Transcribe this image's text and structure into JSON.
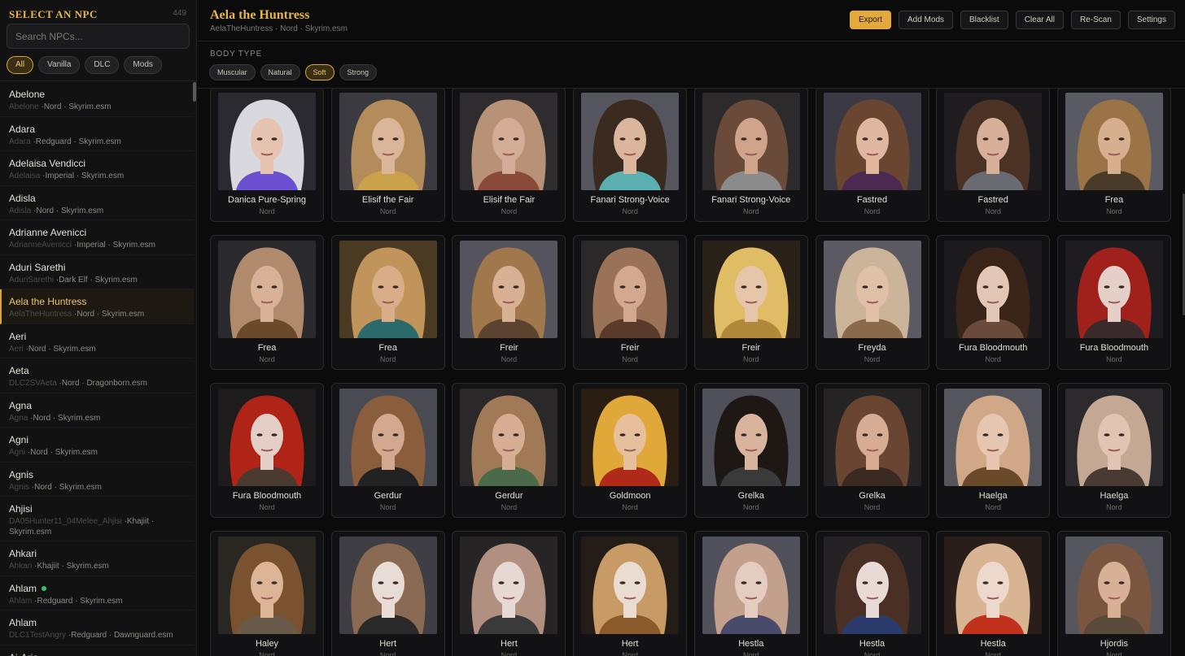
{
  "sidebar": {
    "title": "SELECT AN NPC",
    "count": "449",
    "search_placeholder": "Search NPCs...",
    "filters": [
      {
        "label": "All",
        "active": true
      },
      {
        "label": "Vanilla",
        "active": false
      },
      {
        "label": "DLC",
        "active": false
      },
      {
        "label": "Mods",
        "active": false
      }
    ],
    "npcs": [
      {
        "name": "Abelone",
        "id": "Abelone",
        "race": "Nord",
        "plugin": "Skyrim.esm"
      },
      {
        "name": "Adara",
        "id": "Adara",
        "race": "Redguard",
        "plugin": "Skyrim.esm"
      },
      {
        "name": "Adelaisa Vendicci",
        "id": "Adelaisa",
        "race": "Imperial",
        "plugin": "Skyrim.esm"
      },
      {
        "name": "Adisla",
        "id": "Adisla",
        "race": "Nord",
        "plugin": "Skyrim.esm"
      },
      {
        "name": "Adrianne Avenicci",
        "id": "AdrianneAvenicci",
        "race": "Imperial",
        "plugin": "Skyrim.esm"
      },
      {
        "name": "Aduri Sarethi",
        "id": "AduriSarethi",
        "race": "Dark Elf",
        "plugin": "Skyrim.esm"
      },
      {
        "name": "Aela the Huntress",
        "id": "AelaTheHuntress",
        "race": "Nord",
        "plugin": "Skyrim.esm",
        "selected": true
      },
      {
        "name": "Aeri",
        "id": "Aeri",
        "race": "Nord",
        "plugin": "Skyrim.esm"
      },
      {
        "name": "Aeta",
        "id": "DLC2SVAeta",
        "race": "Nord",
        "plugin": "Dragonborn.esm"
      },
      {
        "name": "Agna",
        "id": "Agna",
        "race": "Nord",
        "plugin": "Skyrim.esm"
      },
      {
        "name": "Agni",
        "id": "Agni",
        "race": "Nord",
        "plugin": "Skyrim.esm"
      },
      {
        "name": "Agnis",
        "id": "Agnis",
        "race": "Nord",
        "plugin": "Skyrim.esm"
      },
      {
        "name": "Ahjisi",
        "id": "DA05Hunter11_04Melee_Ahjisi",
        "race": "Khajiit",
        "plugin": "Skyrim.esm"
      },
      {
        "name": "Ahkari",
        "id": "Ahkari",
        "race": "Khajiit",
        "plugin": "Skyrim.esm"
      },
      {
        "name": "Ahlam",
        "id": "Ahlam",
        "race": "Redguard",
        "plugin": "Skyrim.esm",
        "status": "green"
      },
      {
        "name": "Ahlam",
        "id": "DLC1TestAngry",
        "race": "Redguard",
        "plugin": "Dawnguard.esm"
      },
      {
        "name": "Ai-Aria",
        "id": "",
        "race": "",
        "plugin": ""
      }
    ]
  },
  "header": {
    "title": "Aela the Huntress",
    "subtitle": "AelaTheHuntress · Nord · Skyrim.esm",
    "actions": [
      "Export",
      "Add Mods",
      "Blacklist",
      "Clear All",
      "Re-Scan",
      "Settings"
    ]
  },
  "body_type": {
    "label": "BODY TYPE",
    "options": [
      {
        "label": "Muscular",
        "active": false
      },
      {
        "label": "Natural",
        "active": false
      },
      {
        "label": "Soft",
        "active": true
      },
      {
        "label": "Strong",
        "active": false
      }
    ]
  },
  "presets": [
    {
      "name": "Danica Pure-Spring",
      "race": "Nord",
      "hair": "#d8d8de",
      "skin": "#e6c3b0",
      "bg": "#2a2a30",
      "accent": "#6a4fd0"
    },
    {
      "name": "Elisif the Fair",
      "race": "Nord",
      "hair": "#b48c5c",
      "skin": "#dab59a",
      "bg": "#3a3a40",
      "accent": "#c9a24a"
    },
    {
      "name": "Elisif the Fair",
      "race": "Nord",
      "hair": "#b89276",
      "skin": "#d4ad96",
      "bg": "#2e2c2e",
      "accent": "#8a4a3a"
    },
    {
      "name": "Fanari Strong-Voice",
      "race": "Nord",
      "hair": "#3a2a20",
      "skin": "#dcb69c",
      "bg": "#55555d",
      "accent": "#5ab0b0"
    },
    {
      "name": "Fanari Strong-Voice",
      "race": "Nord",
      "hair": "#6a4a38",
      "skin": "#cfa48a",
      "bg": "#2c2a2b",
      "accent": "#8b8b8b"
    },
    {
      "name": "Fastred",
      "race": "Nord",
      "hair": "#6a4630",
      "skin": "#deb79e",
      "bg": "#3b3a44",
      "accent": "#4a2a50"
    },
    {
      "name": "Fastred",
      "race": "Nord",
      "hair": "#4a3224",
      "skin": "#d8b09a",
      "bg": "#1e1c1e",
      "accent": "#6a6a72"
    },
    {
      "name": "Frea",
      "race": "Nord",
      "hair": "#9a7446",
      "skin": "#d6b08e",
      "bg": "#5a5a62",
      "accent": "#4a3a2a"
    },
    {
      "name": "Frea",
      "race": "Nord",
      "hair": "#b08a6c",
      "skin": "#d8b196",
      "bg": "#2a2a2e",
      "accent": "#6a4a2a"
    },
    {
      "name": "Frea",
      "race": "Nord",
      "hair": "#c0945a",
      "skin": "#d9ad88",
      "bg": "#4a3a22",
      "accent": "#2a6a6a"
    },
    {
      "name": "Freir",
      "race": "Nord",
      "hair": "#a0784c",
      "skin": "#d8b094",
      "bg": "#55545c",
      "accent": "#5a4430"
    },
    {
      "name": "Freir",
      "race": "Nord",
      "hair": "#9a7258",
      "skin": "#d2a88e",
      "bg": "#2a2829",
      "accent": "#5a3a2a"
    },
    {
      "name": "Freir",
      "race": "Nord",
      "hair": "#e0bc64",
      "skin": "#e6c6a8",
      "bg": "#2a2218",
      "accent": "#b08a3a"
    },
    {
      "name": "Freyda",
      "race": "Nord",
      "hair": "#cbb49a",
      "skin": "#e0c0a6",
      "bg": "#5b5a62",
      "accent": "#8a6a4a"
    },
    {
      "name": "Fura Bloodmouth",
      "race": "Nord",
      "hair": "#3a2418",
      "skin": "#e2c6b6",
      "bg": "#1c1a1c",
      "accent": "#6a4a3a"
    },
    {
      "name": "Fura Bloodmouth",
      "race": "Nord",
      "hair": "#a0201c",
      "skin": "#e4d0c8",
      "bg": "#1e1c20",
      "accent": "#3a2a2a"
    },
    {
      "name": "Fura Bloodmouth",
      "race": "Nord",
      "hair": "#b02418",
      "skin": "#e4cfc6",
      "bg": "#1e1b1c",
      "accent": "#4a3a30"
    },
    {
      "name": "Gerdur",
      "race": "Nord",
      "hair": "#8a5e3c",
      "skin": "#d2a890",
      "bg": "#4a4a52",
      "accent": "#222222"
    },
    {
      "name": "Gerdur",
      "race": "Nord",
      "hair": "#a07a56",
      "skin": "#d6ae94",
      "bg": "#2a2829",
      "accent": "#4a6a4a"
    },
    {
      "name": "Goldmoon",
      "race": "Nord",
      "hair": "#e0a838",
      "skin": "#e6c09c",
      "bg": "#2a1e12",
      "accent": "#b02a1a"
    },
    {
      "name": "Grelka",
      "race": "Nord",
      "hair": "#1e1814",
      "skin": "#d8b49c",
      "bg": "#50505a",
      "accent": "#3a3a3a"
    },
    {
      "name": "Grelka",
      "race": "Nord",
      "hair": "#6a4632",
      "skin": "#d6ac92",
      "bg": "#262425",
      "accent": "#3a2a22"
    },
    {
      "name": "Haelga",
      "race": "Nord",
      "hair": "#d0a888",
      "skin": "#e6c6b0",
      "bg": "#55555d",
      "accent": "#6a4a2a"
    },
    {
      "name": "Haelga",
      "race": "Nord",
      "hair": "#c4a894",
      "skin": "#e2c4b2",
      "bg": "#2c2a2c",
      "accent": "#4a3a34"
    },
    {
      "name": "Haley",
      "race": "Nord",
      "hair": "#7a5230",
      "skin": "#dcb496",
      "bg": "#2a2622",
      "accent": "#6a5a4a"
    },
    {
      "name": "Hert",
      "race": "Nord",
      "hair": "#8a6a52",
      "skin": "#e8dcd6",
      "bg": "#3e3e44",
      "accent": "#2a2a2a"
    },
    {
      "name": "Hert",
      "race": "Nord",
      "hair": "#b29080",
      "skin": "#e6d8d2",
      "bg": "#262425",
      "accent": "#3a3a3a"
    },
    {
      "name": "Hert",
      "race": "Nord",
      "hair": "#c89a66",
      "skin": "#eadcd0",
      "bg": "#241c16",
      "accent": "#8a5a2a"
    },
    {
      "name": "Hestla",
      "race": "Nord",
      "hair": "#c2a08c",
      "skin": "#e4ccc0",
      "bg": "#50505a",
      "accent": "#4a4a6a"
    },
    {
      "name": "Hestla",
      "race": "Nord",
      "hair": "#4a3024",
      "skin": "#e8dad4",
      "bg": "#242224",
      "accent": "#2a3a6a"
    },
    {
      "name": "Hestla",
      "race": "Nord",
      "hair": "#d8b492",
      "skin": "#ecd8cc",
      "bg": "#2a1e1a",
      "accent": "#c0301a"
    },
    {
      "name": "Hjordis",
      "race": "Nord",
      "hair": "#7a5640",
      "skin": "#d8b096",
      "bg": "#56565e",
      "accent": "#5a4a3a"
    }
  ]
}
